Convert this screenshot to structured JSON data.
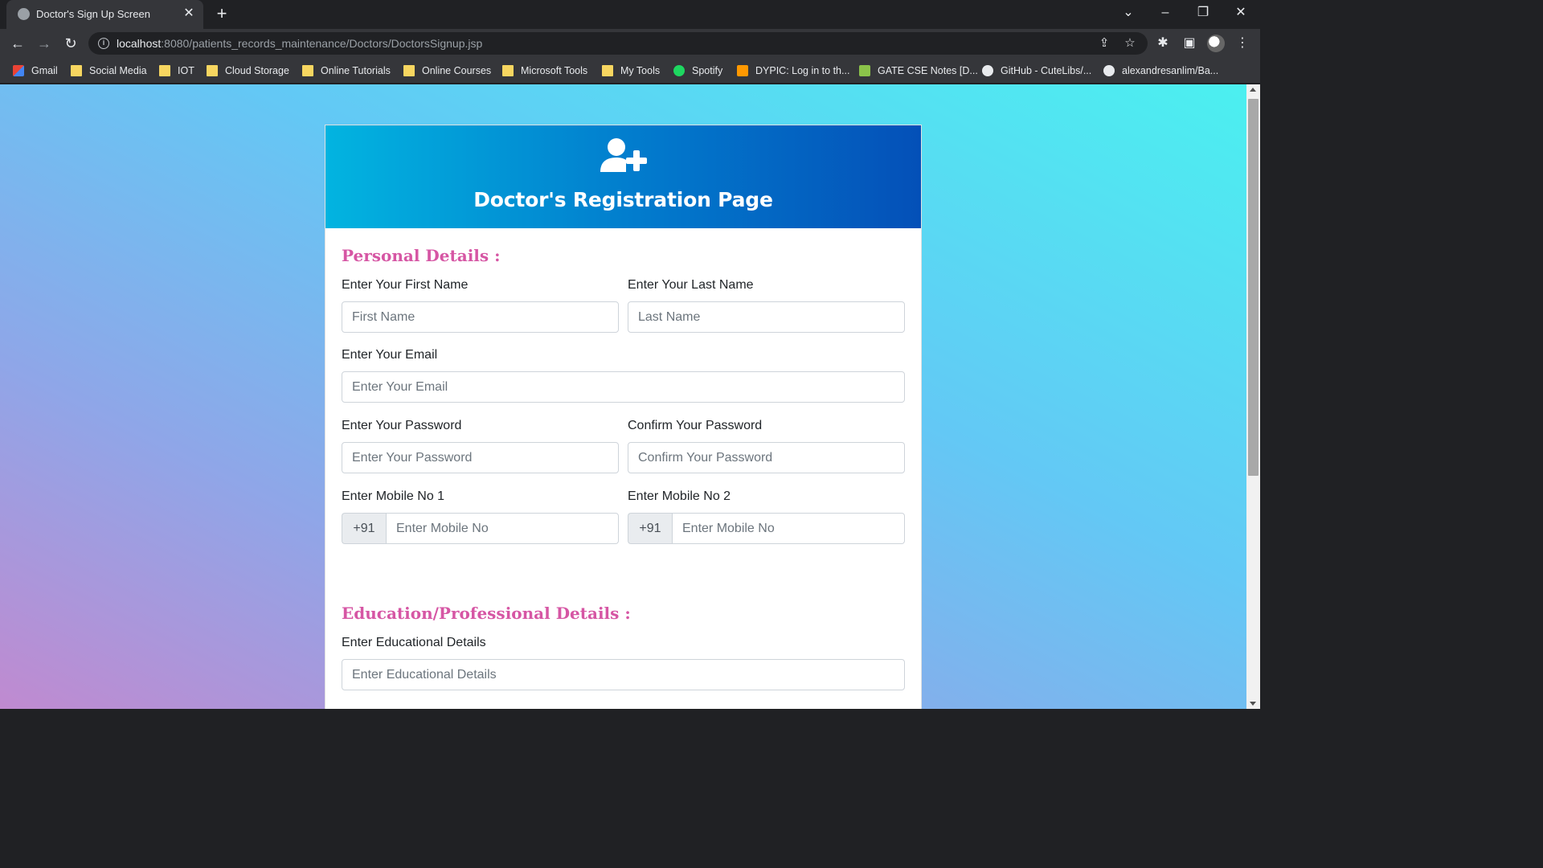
{
  "browser": {
    "tab_title": "Doctor's Sign Up Screen",
    "tab_close": "✕",
    "new_tab": "+",
    "url_host": "localhost",
    "url_rest": ":8080/patients_records_maintenance/Doctors/DoctorsSignup.jsp",
    "bookmarks": [
      {
        "label": "Gmail",
        "icon": "gmail-icon"
      },
      {
        "label": "Social Media",
        "icon": "folder-icon"
      },
      {
        "label": "IOT",
        "icon": "folder-icon"
      },
      {
        "label": "Cloud Storage",
        "icon": "folder-icon"
      },
      {
        "label": "Online Tutorials",
        "icon": "folder-icon"
      },
      {
        "label": "Online Courses",
        "icon": "folder-icon"
      },
      {
        "label": "Microsoft Tools",
        "icon": "folder-icon"
      },
      {
        "label": "My Tools",
        "icon": "folder-icon"
      },
      {
        "label": "Spotify",
        "icon": "spotify-icon"
      },
      {
        "label": "DYPIC: Log in to th...",
        "icon": "dypic-icon"
      },
      {
        "label": "GATE CSE Notes [D...",
        "icon": "gate-icon"
      },
      {
        "label": "GitHub - CuteLibs/...",
        "icon": "github-icon"
      },
      {
        "label": "alexandresanlim/Ba...",
        "icon": "github-icon"
      }
    ]
  },
  "form": {
    "header_title": "Doctor's Registration Page",
    "header_icon": "user-plus-icon",
    "personal_title": "Personal Details :",
    "first_name_label": "Enter Your First Name",
    "first_name_placeholder": "First Name",
    "last_name_label": "Enter Your Last Name",
    "last_name_placeholder": "Last Name",
    "email_label": "Enter Your Email",
    "email_placeholder": "Enter Your Email",
    "password_label": "Enter Your Password",
    "password_placeholder": "Enter Your Password",
    "confirm_label": "Confirm Your Password",
    "confirm_placeholder": "Confirm Your Password",
    "mobile1_label": "Enter Mobile No 1",
    "mobile2_label": "Enter Mobile No 2",
    "mobile_prefix": "+91",
    "mobile_placeholder": "Enter Mobile No",
    "education_title": "Education/Professional Details :",
    "education_label": "Enter Educational Details",
    "education_placeholder": "Enter Educational Details"
  },
  "colors": {
    "section_title": "#d656a4",
    "header_gradient_start": "#02b4e0",
    "header_gradient_end": "#0450b8"
  }
}
